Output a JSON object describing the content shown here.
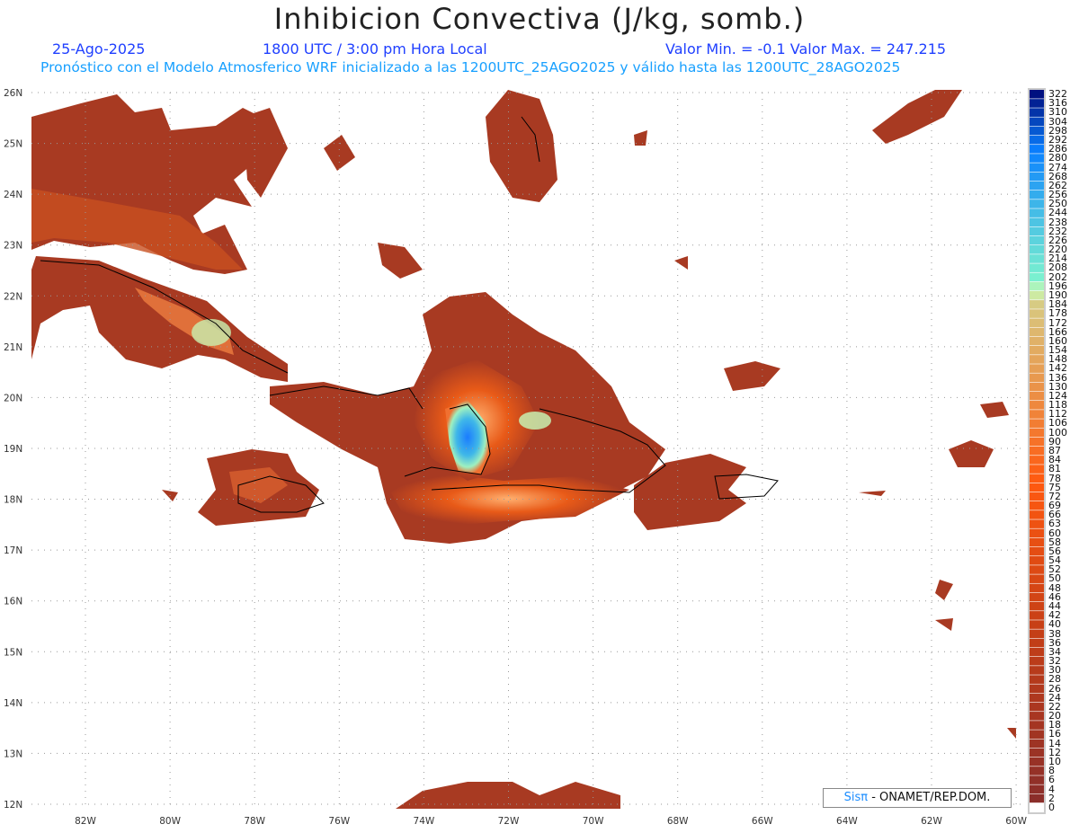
{
  "title": "Inhibicion Convectiva (J/kg, somb.)",
  "date": "25-Ago-2025",
  "time": "1800 UTC / 3:00 pm Hora Local",
  "minmax": "Valor Min. = -0.1  Valor Max. = 247.215",
  "forecast_line": "Pronóstico con el Modelo Atmosferico WRF inicializado a las 1200UTC_25AGO2025 y válido hasta las  1200UTC_28AGO2025",
  "credit_brand": "Sisπ",
  "credit_text": " - ONAMET/REP.DOM.",
  "lon_labels": [
    "82W",
    "80W",
    "78W",
    "76W",
    "74W",
    "72W",
    "70W",
    "68W",
    "66W",
    "64W",
    "62W",
    "60W"
  ],
  "lat_labels": [
    "26N",
    "25N",
    "24N",
    "23N",
    "22N",
    "21N",
    "20N",
    "19N",
    "18N",
    "17N",
    "16N",
    "15N",
    "14N",
    "13N",
    "12N"
  ],
  "colorbar_levels": [
    "322",
    "316",
    "310",
    "304",
    "298",
    "292",
    "286",
    "280",
    "274",
    "268",
    "262",
    "256",
    "250",
    "244",
    "238",
    "232",
    "226",
    "220",
    "214",
    "208",
    "202",
    "196",
    "190",
    "184",
    "178",
    "172",
    "166",
    "160",
    "154",
    "148",
    "142",
    "136",
    "130",
    "124",
    "118",
    "112",
    "106",
    "100",
    "90",
    "87",
    "84",
    "81",
    "78",
    "75",
    "72",
    "69",
    "66",
    "63",
    "60",
    "58",
    "56",
    "54",
    "52",
    "50",
    "48",
    "46",
    "44",
    "42",
    "40",
    "38",
    "36",
    "34",
    "32",
    "30",
    "28",
    "26",
    "24",
    "22",
    "20",
    "18",
    "16",
    "14",
    "12",
    "10",
    "8",
    "6",
    "4",
    "2",
    "0"
  ],
  "colors": {
    "low": "#8b2e2a",
    "mid": "#ff5a10",
    "pale": "#c8f7b0",
    "cyan": "#7af0d0",
    "blue": "#1a7cff",
    "dark": "#001080"
  }
}
